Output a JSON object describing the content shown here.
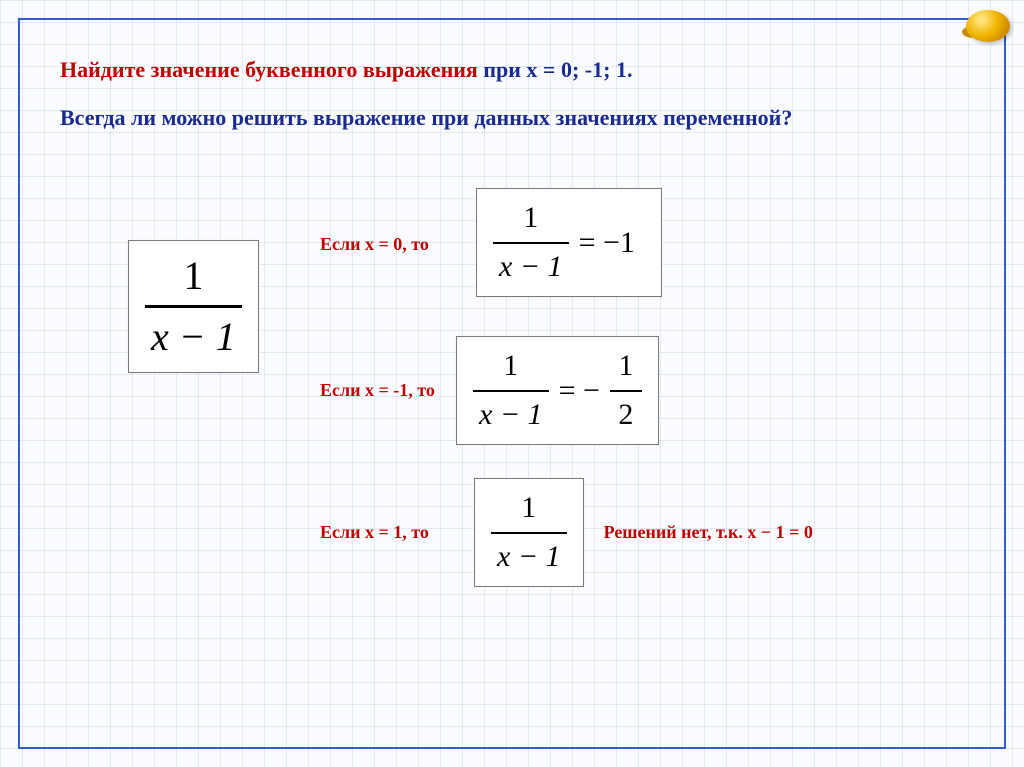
{
  "heading": {
    "p1_red": "Найдите значение буквенного выражения ",
    "p1_navy": "при х = 0; -1; 1.",
    "p2_navy": "Всегда ли можно решить выражение при данных значениях переменной?"
  },
  "main_expression": {
    "numerator": "1",
    "denominator": "x − 1"
  },
  "cases": [
    {
      "label": "Если  х = 0, то",
      "lhs_num": "1",
      "lhs_den": "x − 1",
      "eq": "= −1"
    },
    {
      "label": "Если  х = -1, то",
      "lhs_num": "1",
      "lhs_den": "x − 1",
      "mid": "= −",
      "rhs_num": "1",
      "rhs_den": "2"
    },
    {
      "label": "Если  х = 1, то",
      "lhs_num": "1",
      "lhs_den": "x − 1",
      "note": "Решений нет, т.к. х − 1 = 0"
    }
  ]
}
